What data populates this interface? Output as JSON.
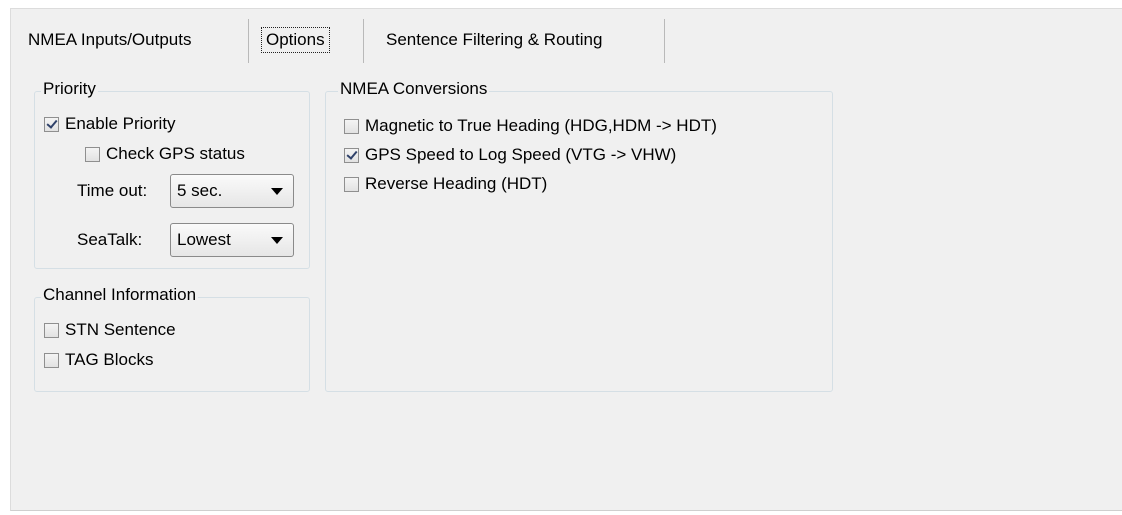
{
  "tabs": [
    {
      "label": "NMEA Inputs/Outputs",
      "active": false
    },
    {
      "label": "Options",
      "active": true
    },
    {
      "label": "Sentence Filtering & Routing",
      "active": false
    }
  ],
  "priority": {
    "legend": "Priority",
    "enable_priority": {
      "label": "Enable Priority",
      "checked": true
    },
    "check_gps_status": {
      "label": "Check GPS status",
      "checked": false
    },
    "timeout": {
      "label": "Time out:",
      "value": "5 sec."
    },
    "seatalk": {
      "label": "SeaTalk:",
      "value": "Lowest"
    }
  },
  "channel_info": {
    "legend": "Channel Information",
    "stn_sentence": {
      "label": "STN Sentence",
      "checked": false
    },
    "tag_blocks": {
      "label": "TAG Blocks",
      "checked": false
    }
  },
  "nmea_conversions": {
    "legend": "NMEA Conversions",
    "items": [
      {
        "label": "Magnetic to True Heading (HDG,HDM -> HDT)",
        "checked": false
      },
      {
        "label": "GPS Speed to Log Speed (VTG -> VHW)",
        "checked": true
      },
      {
        "label": "Reverse Heading (HDT)",
        "checked": false
      }
    ]
  },
  "colors": {
    "panel_bg": "#f0f0f0",
    "group_border": "#d5dfe5",
    "check_color": "#30426a"
  }
}
